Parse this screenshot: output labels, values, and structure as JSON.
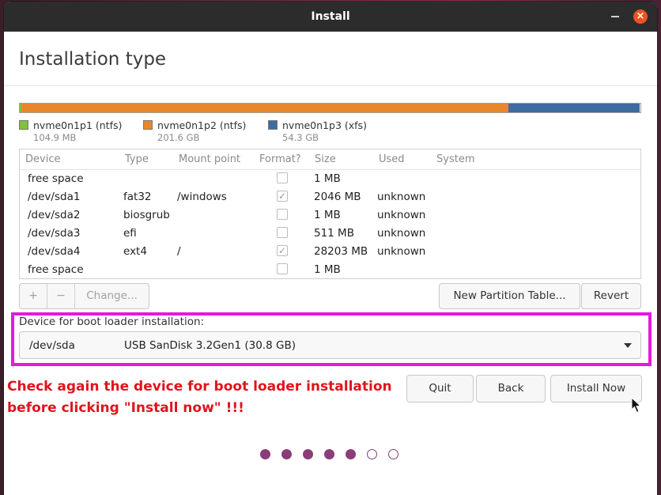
{
  "window": {
    "title": "Install",
    "minimize_icon": "minimize-icon",
    "close_icon": "close-icon",
    "close_glyph": "×",
    "accent_color": "#e95420"
  },
  "page": {
    "title": "Installation type"
  },
  "partitions_bar": [
    {
      "name": "nvme0n1p1 (ntfs)",
      "size": "104.9 MB",
      "color": "#7ec143",
      "share": 0.0003
    },
    {
      "name": "nvme0n1p2 (ntfs)",
      "size": "201.6 GB",
      "color": "#e8862b",
      "share": 0.787
    },
    {
      "name": "nvme0n1p3 (xfs)",
      "size": "54.3 GB",
      "color": "#3e6ba0",
      "share": 0.212
    }
  ],
  "table": {
    "headers": {
      "device": "Device",
      "type": "Type",
      "mount": "Mount point",
      "format": "Format?",
      "size": "Size",
      "used": "Used",
      "system": "System"
    },
    "rows": [
      {
        "device": "free space",
        "type": "",
        "mount": "",
        "format": false,
        "size": "1 MB",
        "used": "",
        "system": ""
      },
      {
        "device": "/dev/sda1",
        "type": "fat32",
        "mount": "/windows",
        "format": true,
        "size": "2046 MB",
        "used": "unknown",
        "system": ""
      },
      {
        "device": "/dev/sda2",
        "type": "biosgrub",
        "mount": "",
        "format": false,
        "size": "1 MB",
        "used": "unknown",
        "system": ""
      },
      {
        "device": "/dev/sda3",
        "type": "efi",
        "mount": "",
        "format": false,
        "size": "511 MB",
        "used": "unknown",
        "system": ""
      },
      {
        "device": "/dev/sda4",
        "type": "ext4",
        "mount": "/",
        "format": true,
        "size": "28203 MB",
        "used": "unknown",
        "system": ""
      },
      {
        "device": "free space",
        "type": "",
        "mount": "",
        "format": false,
        "size": "1 MB",
        "used": "",
        "system": ""
      }
    ],
    "check_glyph": "✓"
  },
  "controls": {
    "add_label": "+",
    "remove_label": "−",
    "change_label": "Change...",
    "new_table_label": "New Partition Table...",
    "revert_label": "Revert"
  },
  "boot_loader": {
    "label": "Device for boot loader installation:",
    "device": "/dev/sda",
    "description": "USB  SanDisk 3.2Gen1 (30.8 GB)",
    "highlight_color": "#e21ae0"
  },
  "annotation": {
    "line1": "Check again the device for boot loader installation",
    "line2": "before clicking \"Install now\" !!!",
    "color": "#e0141e"
  },
  "actions": {
    "quit_label": "Quit",
    "back_label": "Back",
    "install_label": "Install Now"
  },
  "progress": {
    "total_steps": 7,
    "completed_steps": 5,
    "filled_color": "#8a3d77"
  }
}
